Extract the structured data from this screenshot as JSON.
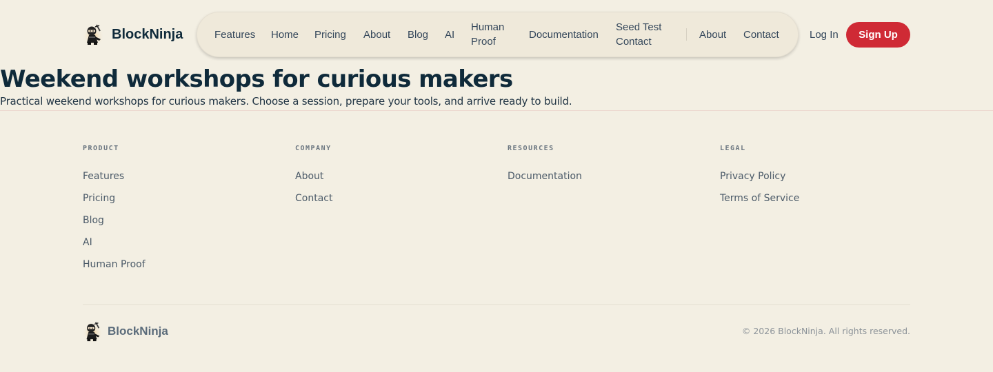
{
  "brand": {
    "name": "BlockNinja",
    "logo_icon": "ninja-logo-icon"
  },
  "nav": {
    "items": [
      "Features",
      "Home",
      "Pricing",
      "About",
      "Blog",
      "AI",
      "Human Proof",
      "Documentation",
      "Seed Test Contact",
      "About",
      "Contact"
    ]
  },
  "auth": {
    "login": "Log In",
    "signup": "Sign Up"
  },
  "colors": {
    "accent": "#cf2a35",
    "text": "#0f2a3a",
    "background": "#f3efe3"
  },
  "hero": {
    "title": "Weekend workshops for curious makers",
    "subtitle": "Practical weekend workshops for curious makers. Choose a session, prepare your tools, and arrive ready to build."
  },
  "footer": {
    "columns": [
      {
        "heading": "PRODUCT",
        "links": [
          "Features",
          "Pricing",
          "Blog",
          "AI",
          "Human Proof"
        ]
      },
      {
        "heading": "COMPANY",
        "links": [
          "About",
          "Contact"
        ]
      },
      {
        "heading": "RESOURCES",
        "links": [
          "Documentation"
        ]
      },
      {
        "heading": "LEGAL",
        "links": [
          "Privacy Policy",
          "Terms of Service"
        ]
      }
    ],
    "brand_name": "BlockNinja",
    "copyright": "© 2026 BlockNinja. All rights reserved."
  }
}
